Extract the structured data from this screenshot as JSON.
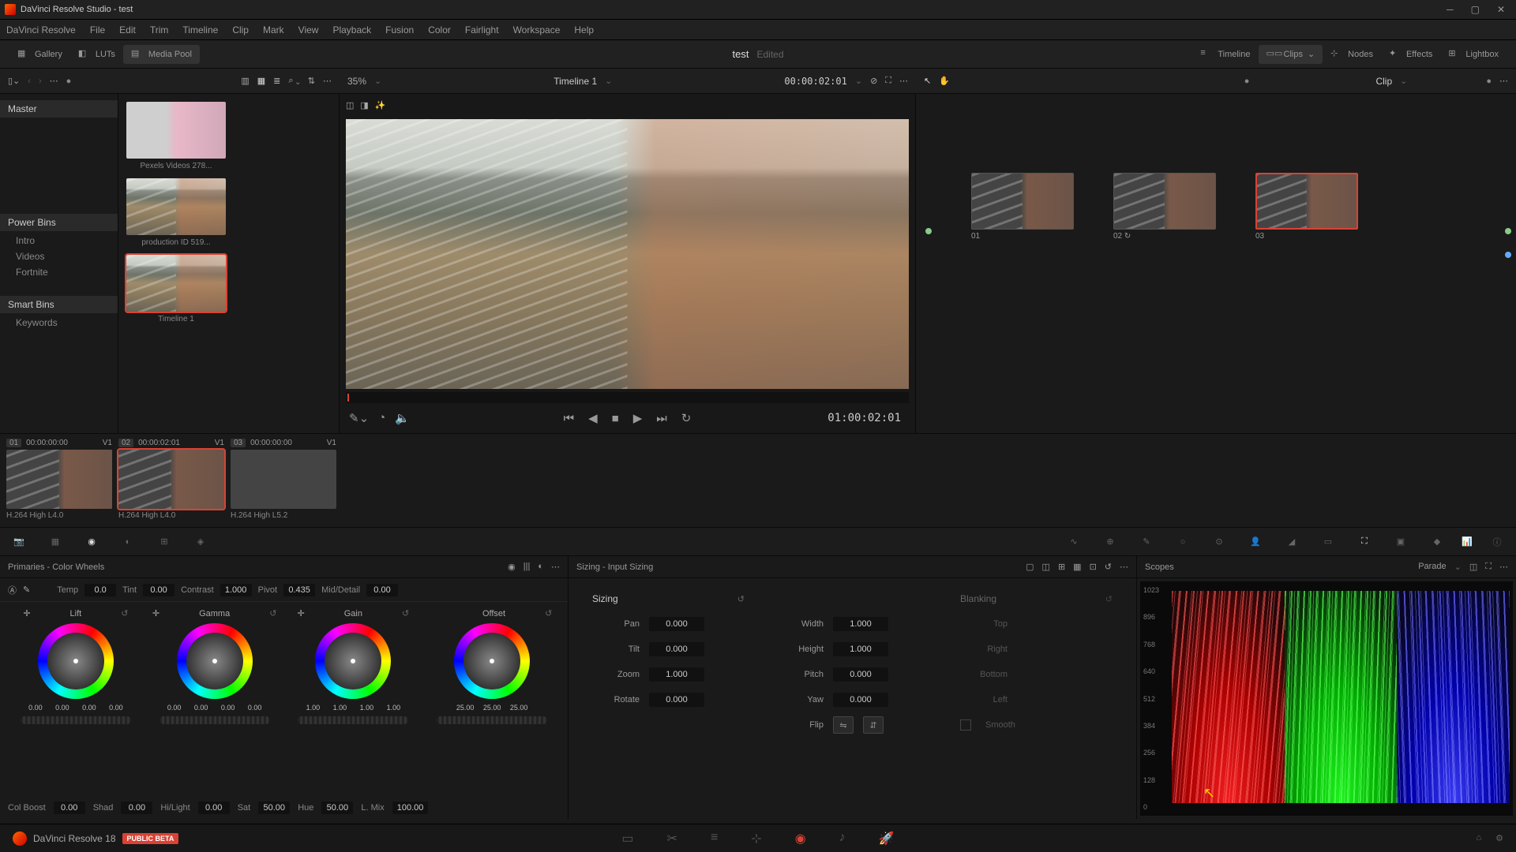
{
  "window": {
    "title": "DaVinci Resolve Studio - test"
  },
  "menus": [
    "DaVinci Resolve",
    "File",
    "Edit",
    "Trim",
    "Timeline",
    "Clip",
    "Mark",
    "View",
    "Playback",
    "Fusion",
    "Color",
    "Fairlight",
    "Workspace",
    "Help"
  ],
  "topbar": {
    "gallery": "Gallery",
    "luts": "LUTs",
    "mediapool": "Media Pool",
    "timeline": "Timeline",
    "clips": "Clips",
    "nodes": "Nodes",
    "effects": "Effects",
    "lightbox": "Lightbox",
    "project": "test",
    "edited": "Edited"
  },
  "toolbar": {
    "zoom": "35%",
    "timeline_name": "Timeline 1",
    "timecode": "00:00:02:01",
    "node_mode": "Clip"
  },
  "browser": {
    "master": "Master",
    "powerbins": "Power Bins",
    "pb_items": [
      "Intro",
      "Videos",
      "Fortnite"
    ],
    "smartbins": "Smart Bins",
    "sb_items": [
      "Keywords"
    ]
  },
  "media": [
    {
      "name": "Pexels Videos 278..."
    },
    {
      "name": "production ID 519..."
    },
    {
      "name": "Timeline 1"
    }
  ],
  "viewer": {
    "tc": "01:00:02:01"
  },
  "nodes": [
    {
      "id": "01"
    },
    {
      "id": "02"
    },
    {
      "id": "03"
    }
  ],
  "clips": [
    {
      "num": "01",
      "tc": "00:00:00:00",
      "track": "V1",
      "codec": "H.264 High L4.0"
    },
    {
      "num": "02",
      "tc": "00:00:02:01",
      "track": "V1",
      "codec": "H.264 High L4.0"
    },
    {
      "num": "03",
      "tc": "00:00:00:00",
      "track": "V1",
      "codec": "H.264 High L5.2"
    }
  ],
  "primaries": {
    "title": "Primaries - Color Wheels",
    "top": {
      "temp_l": "Temp",
      "temp": "0.0",
      "tint_l": "Tint",
      "tint": "0.00",
      "contrast_l": "Contrast",
      "contrast": "1.000",
      "pivot_l": "Pivot",
      "pivot": "0.435",
      "md_l": "Mid/Detail",
      "md": "0.00"
    },
    "wheels": {
      "lift": {
        "label": "Lift",
        "vals": [
          "0.00",
          "0.00",
          "0.00",
          "0.00"
        ]
      },
      "gamma": {
        "label": "Gamma",
        "vals": [
          "0.00",
          "0.00",
          "0.00",
          "0.00"
        ]
      },
      "gain": {
        "label": "Gain",
        "vals": [
          "1.00",
          "1.00",
          "1.00",
          "1.00"
        ]
      },
      "offset": {
        "label": "Offset",
        "vals": [
          "25.00",
          "25.00",
          "25.00"
        ]
      }
    },
    "bottom": {
      "cb_l": "Col Boost",
      "cb": "0.00",
      "shad_l": "Shad",
      "shad": "0.00",
      "hl_l": "Hi/Light",
      "hl": "0.00",
      "sat_l": "Sat",
      "sat": "50.00",
      "hue_l": "Hue",
      "hue": "50.00",
      "lmix_l": "L. Mix",
      "lmix": "100.00"
    }
  },
  "sizing": {
    "title": "Sizing - Input Sizing",
    "hdr": "Sizing",
    "pan_l": "Pan",
    "pan": "0.000",
    "tilt_l": "Tilt",
    "tilt": "0.000",
    "zoom_l": "Zoom",
    "zoom": "1.000",
    "rotate_l": "Rotate",
    "rotate": "0.000",
    "width_l": "Width",
    "width": "1.000",
    "height_l": "Height",
    "height": "1.000",
    "pitch_l": "Pitch",
    "pitch": "0.000",
    "yaw_l": "Yaw",
    "yaw": "0.000",
    "flip_l": "Flip",
    "blanking": "Blanking",
    "top": "Top",
    "right": "Right",
    "bottom": "Bottom",
    "left": "Left",
    "smooth": "Smooth"
  },
  "scopes": {
    "title": "Scopes",
    "mode": "Parade",
    "ticks": [
      "1023",
      "896",
      "768",
      "640",
      "512",
      "384",
      "256",
      "128",
      "0"
    ]
  },
  "footer": {
    "version": "DaVinci Resolve 18",
    "beta": "PUBLIC BETA"
  }
}
